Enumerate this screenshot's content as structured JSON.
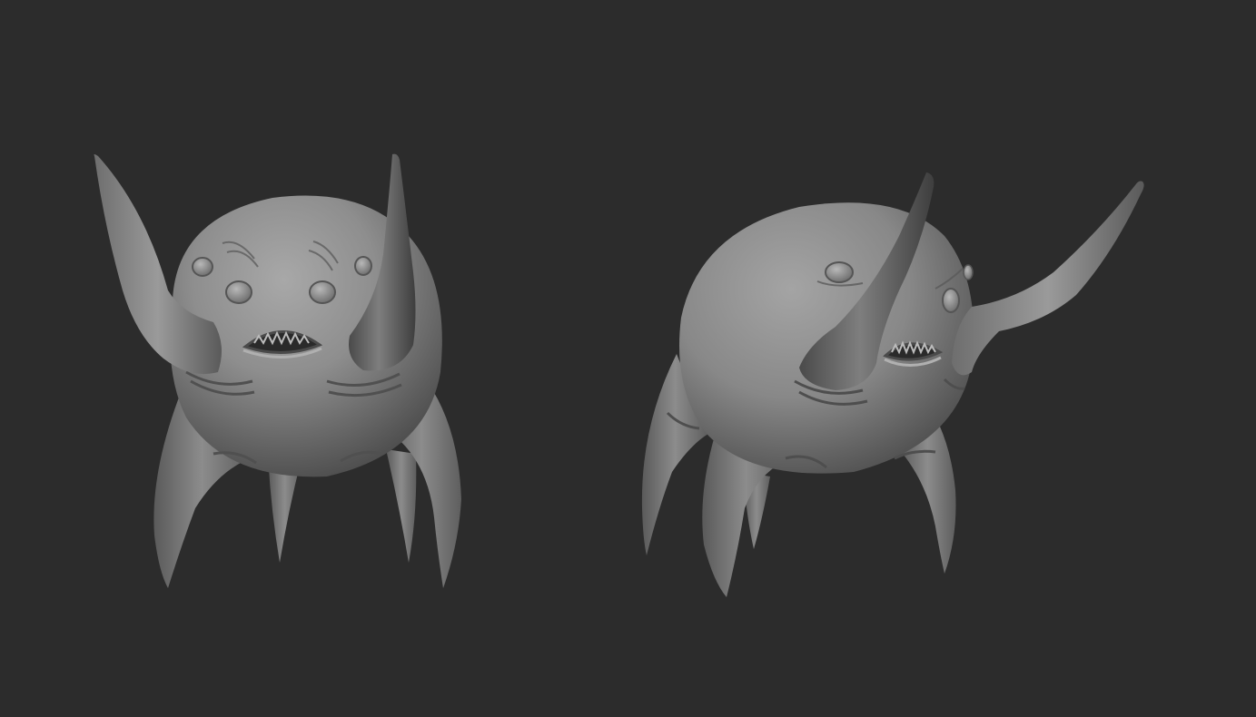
{
  "scene": {
    "background_color": "#2c2c2c",
    "clay_color": "#8a8a8a",
    "subject": "sculpted-creature",
    "views": [
      {
        "name": "front-view"
      },
      {
        "name": "three-quarter-view"
      }
    ]
  }
}
